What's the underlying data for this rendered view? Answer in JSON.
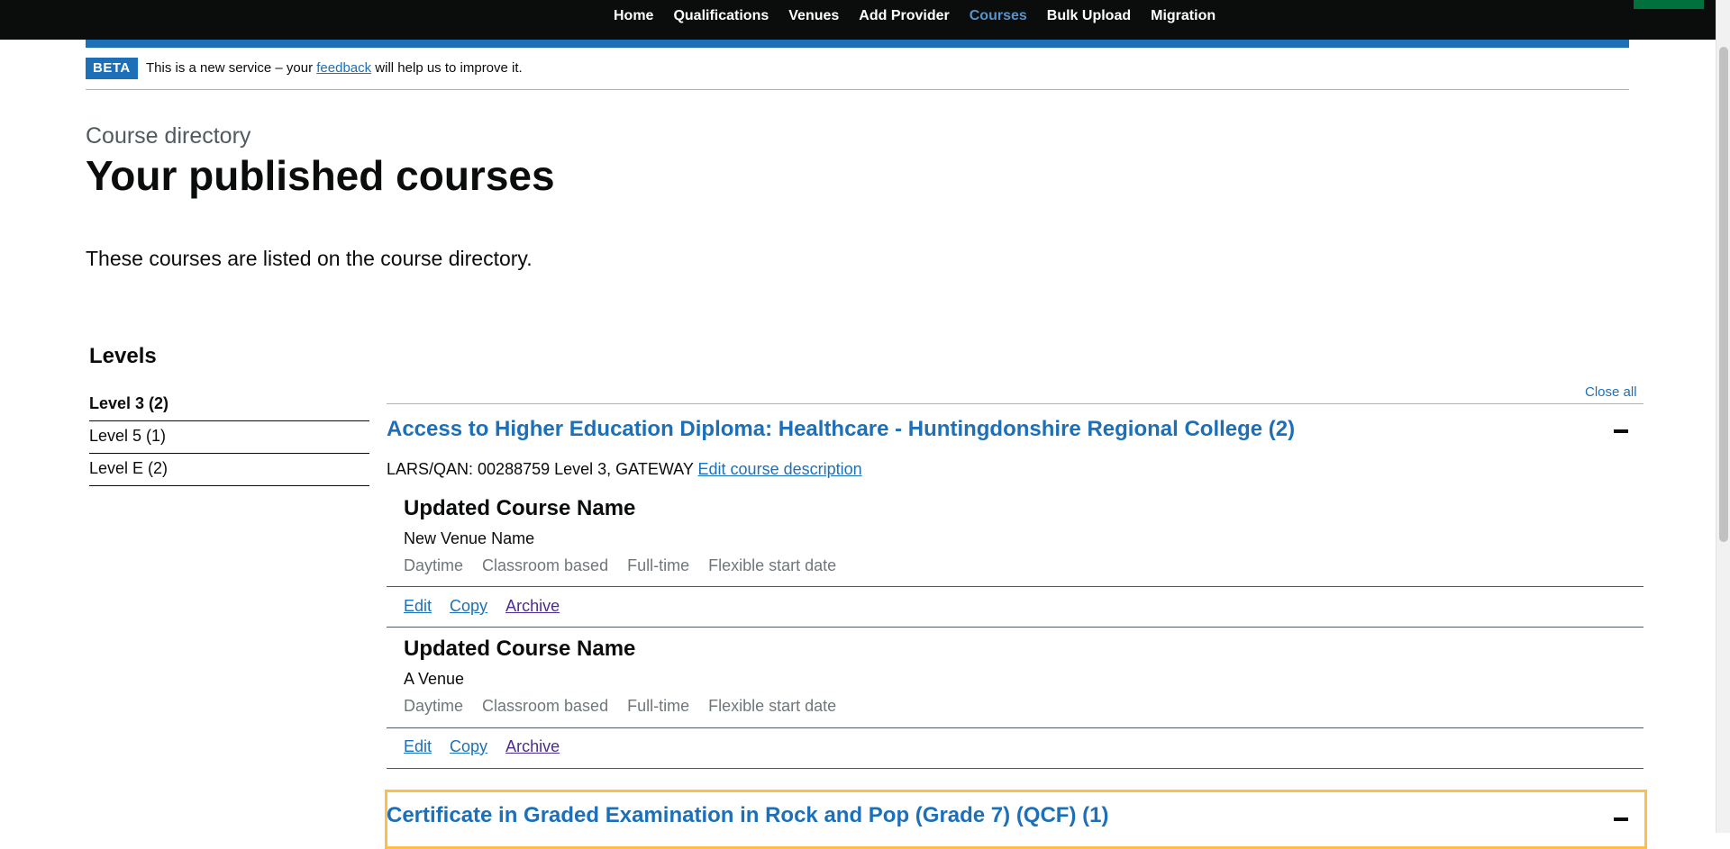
{
  "nav": {
    "items": [
      "Home",
      "Qualifications",
      "Venues",
      "Add Provider",
      "Courses",
      "Bulk Upload",
      "Migration"
    ],
    "active": "Courses"
  },
  "colors": {
    "brand_blue": "#1d70b8",
    "header_black": "#0b0c0c",
    "accent_green": "#00703c",
    "focus_yellow": "#ffbf47",
    "visited_link": "#4c2c92"
  },
  "beta": {
    "tag": "BETA",
    "text_before": "This is a new service – your ",
    "link": "feedback",
    "text_after": " will help us to improve it."
  },
  "page": {
    "caption": "Course directory",
    "title": "Your published courses",
    "lede": "These courses are listed on the course directory."
  },
  "levels": {
    "heading": "Levels",
    "items": [
      "Level 3 (2)",
      "Level 5 (1)",
      "Level E (2)"
    ],
    "selected": "Level 3 (2)"
  },
  "accordion": {
    "close_all": "Close all",
    "sections": [
      {
        "title": "Access to Higher Education Diploma: Healthcare - Huntingdonshire Regional College (2)",
        "lars_text": "LARS/QAN: 00288759 Level 3, GATEWAY",
        "edit_description": "Edit course description",
        "courses": [
          {
            "name": "Updated Course Name",
            "venue": "New Venue Name",
            "attributes": [
              "Daytime",
              "Classroom based",
              "Full-time",
              "Flexible start date"
            ],
            "actions": [
              "Edit",
              "Copy",
              "Archive"
            ]
          },
          {
            "name": "Updated Course Name",
            "venue": "A Venue",
            "attributes": [
              "Daytime",
              "Classroom based",
              "Full-time",
              "Flexible start date"
            ],
            "actions": [
              "Edit",
              "Copy",
              "Archive"
            ]
          }
        ]
      },
      {
        "title": "Certificate in Graded Examination in Rock and Pop (Grade 7) (QCF) (1)"
      }
    ]
  }
}
